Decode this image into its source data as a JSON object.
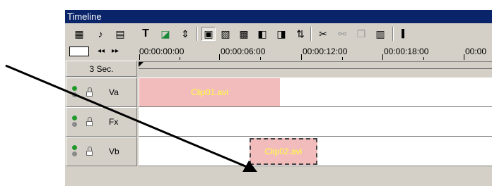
{
  "window": {
    "title": "Timeline"
  },
  "toolbar": {
    "icons": [
      {
        "name": "storyboard-icon",
        "glyph": "▦"
      },
      {
        "name": "audio-icon",
        "glyph": "♪"
      },
      {
        "name": "document-icon",
        "glyph": "▤"
      },
      {
        "name": "title-text-icon",
        "glyph": "T"
      },
      {
        "name": "overlay-icon",
        "glyph": "◪"
      },
      {
        "name": "split-icon",
        "glyph": "⇕"
      },
      {
        "name": "track-view-icon",
        "glyph": "▣"
      },
      {
        "name": "transition-view-icon",
        "glyph": "▨"
      },
      {
        "name": "fx-view-icon",
        "glyph": "▩"
      },
      {
        "name": "mark-in-icon",
        "glyph": "◧"
      },
      {
        "name": "mark-out-icon",
        "glyph": "◨"
      },
      {
        "name": "ripple-icon",
        "glyph": "⇅"
      },
      {
        "name": "cut-icon",
        "glyph": "✂"
      },
      {
        "name": "link-icon",
        "glyph": "⚯"
      },
      {
        "name": "copy-icon",
        "glyph": "❐"
      },
      {
        "name": "group-icon",
        "glyph": "▥"
      }
    ]
  },
  "ruler": {
    "timecodes": [
      "00:00:00:00",
      "00:00:06:00",
      "00:00:12:00",
      "00:00:18:00",
      "00:00"
    ]
  },
  "zoom": {
    "label": "3 Sec."
  },
  "tracks": [
    {
      "name": "Va",
      "clip": "Clip01.avi"
    },
    {
      "name": "Fx",
      "clip": ""
    },
    {
      "name": "Vb",
      "clip": "Clip02.avi"
    }
  ],
  "colors": {
    "title_bar": "#0a246a",
    "clip_fill": "#f2bcbc",
    "clip_text": "#ffff3c",
    "lamp_green": "#1f9a2a"
  }
}
